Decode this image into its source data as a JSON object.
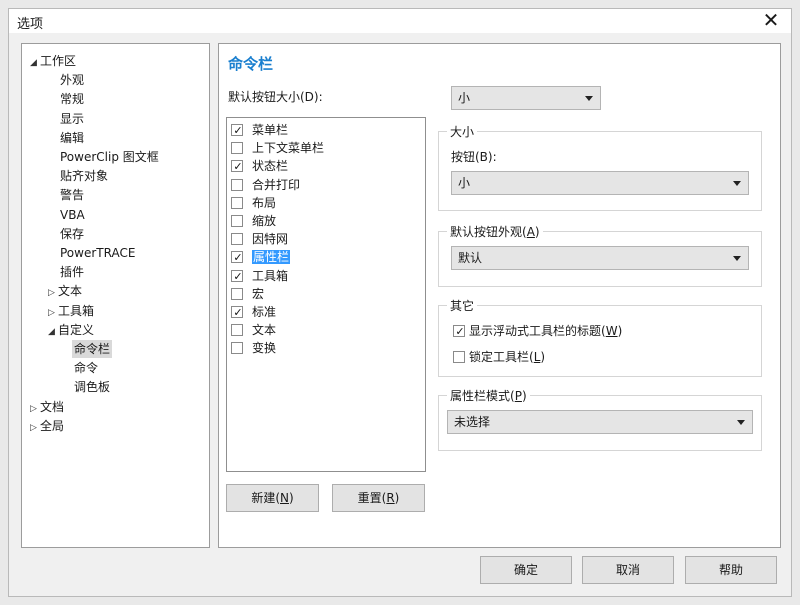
{
  "window": {
    "title": "选项",
    "close_glyph": "✕"
  },
  "tree": [
    {
      "label": "工作区",
      "expander": "◢",
      "depth": 0
    },
    {
      "label": "外观",
      "expander": "",
      "depth": 1
    },
    {
      "label": "常规",
      "expander": "",
      "depth": 1
    },
    {
      "label": "显示",
      "expander": "",
      "depth": 1
    },
    {
      "label": "编辑",
      "expander": "",
      "depth": 1
    },
    {
      "label": "PowerClip 图文框",
      "expander": "",
      "depth": 1
    },
    {
      "label": "贴齐对象",
      "expander": "",
      "depth": 1
    },
    {
      "label": "警告",
      "expander": "",
      "depth": 1
    },
    {
      "label": "VBA",
      "expander": "",
      "depth": 1
    },
    {
      "label": "保存",
      "expander": "",
      "depth": 1
    },
    {
      "label": "PowerTRACE",
      "expander": "",
      "depth": 1
    },
    {
      "label": "插件",
      "expander": "",
      "depth": 1
    },
    {
      "label": "文本",
      "expander": "▷",
      "depth": 0.5
    },
    {
      "label": "工具箱",
      "expander": "▷",
      "depth": 0.5
    },
    {
      "label": "自定义",
      "expander": "◢",
      "depth": 0.5
    },
    {
      "label": "命令栏",
      "expander": "",
      "depth": 2,
      "selected": true
    },
    {
      "label": "命令",
      "expander": "",
      "depth": 2
    },
    {
      "label": "调色板",
      "expander": "",
      "depth": 2
    },
    {
      "label": "文档",
      "expander": "▷",
      "depth": 0
    },
    {
      "label": "全局",
      "expander": "▷",
      "depth": 0
    }
  ],
  "panel": {
    "section_title": "命令栏",
    "default_button_size_label": "默认按钮大小(D):",
    "default_button_size_value": "小",
    "commandbars": [
      {
        "label": "菜单栏",
        "checked": true
      },
      {
        "label": "上下文菜单栏",
        "checked": false
      },
      {
        "label": "状态栏",
        "checked": true
      },
      {
        "label": "合并打印",
        "checked": false
      },
      {
        "label": "布局",
        "checked": false
      },
      {
        "label": "缩放",
        "checked": false
      },
      {
        "label": "因特网",
        "checked": false
      },
      {
        "label": "属性栏",
        "checked": true,
        "highlight": true
      },
      {
        "label": "工具箱",
        "checked": true
      },
      {
        "label": "宏",
        "checked": false
      },
      {
        "label": "标准",
        "checked": true
      },
      {
        "label": "文本",
        "checked": false
      },
      {
        "label": "变换",
        "checked": false
      }
    ],
    "new_button": {
      "text": "新建(",
      "key": "N",
      "end": ")"
    },
    "reset_button": {
      "text": "重置(",
      "key": "R",
      "end": ")"
    },
    "size_group": {
      "title": "大小",
      "button_label": "按钮(B):",
      "button_value": "小"
    },
    "appearance_group": {
      "title_text": "默认按钮外观(",
      "title_key": "A",
      "title_end": ")",
      "value": "默认"
    },
    "other_group": {
      "title": "其它",
      "show_floating_title": {
        "text": "显示浮动式工具栏的标题(",
        "key": "W",
        "end": ")",
        "checked": true
      },
      "lock_toolbar": {
        "text": "锁定工具栏(",
        "key": "L",
        "end": ")",
        "checked": false
      }
    },
    "property_bar_mode_group": {
      "title_text": "属性栏模式(",
      "title_key": "P",
      "title_end": ")",
      "value": "未选择"
    }
  },
  "footer": {
    "ok": "确定",
    "cancel": "取消",
    "help": "帮助"
  }
}
